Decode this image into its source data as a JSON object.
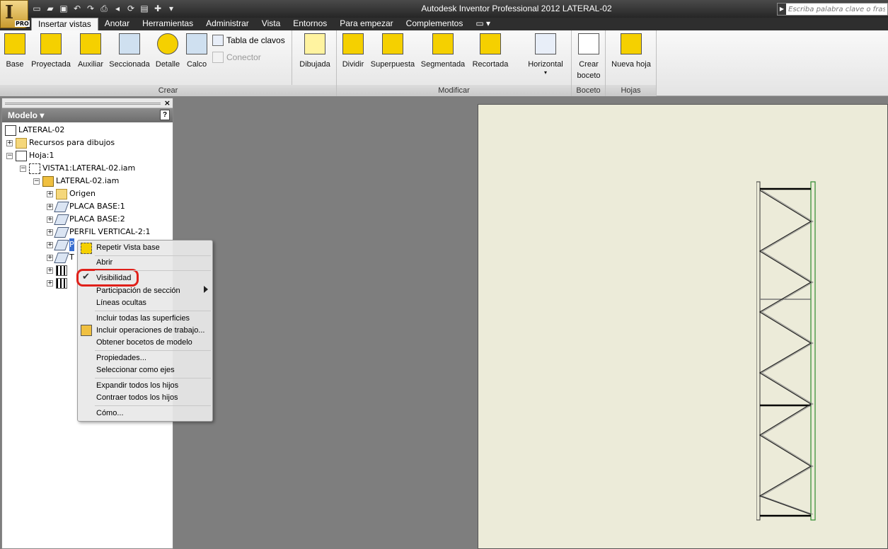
{
  "window": {
    "title": "Autodesk Inventor Professional 2012    LATERAL-02"
  },
  "app_button": {
    "badge": "PRO"
  },
  "search": {
    "placeholder": "Escriba palabra clave o frase"
  },
  "tabs": [
    "Insertar vistas",
    "Anotar",
    "Herramientas",
    "Administrar",
    "Vista",
    "Entornos",
    "Para empezar",
    "Complementos"
  ],
  "ribbon": {
    "crear": {
      "label": "Crear",
      "buttons": [
        "Base",
        "Proyectada",
        "Auxiliar",
        "Seccionada",
        "Detalle",
        "Calco"
      ],
      "small": [
        "Tabla de clavos",
        "Conector"
      ]
    },
    "dibujada": "Dibujada",
    "modificar": {
      "label": "Modificar",
      "buttons": [
        "Dividir",
        "Superpuesta",
        "Segmentada",
        "Recortada",
        "Horizontal"
      ]
    },
    "boceto": {
      "label": "Boceto",
      "button_line1": "Crear",
      "button_line2": "boceto"
    },
    "hojas": {
      "label": "Hojas",
      "button": "Nueva hoja"
    }
  },
  "browser": {
    "title": "Modelo",
    "help": "?",
    "tree": [
      {
        "label": "LATERAL-02"
      },
      {
        "label": "Recursos para dibujos"
      },
      {
        "label": "Hoja:1"
      },
      {
        "label": "VISTA1:LATERAL-02.iam"
      },
      {
        "label": "LATERAL-02.iam"
      },
      {
        "label": "Origen"
      },
      {
        "label": "PLACA BASE:1"
      },
      {
        "label": "PLACA BASE:2"
      },
      {
        "label": "PERFIL VERTICAL-2:1"
      },
      {
        "label": "P"
      },
      {
        "label": "T"
      }
    ]
  },
  "context_menu": {
    "items": [
      "Repetir Vista base",
      "Abrir",
      "Visibilidad",
      "Participación de sección",
      "Líneas ocultas",
      "Incluir todas las superficies",
      "Incluir operaciones de trabajo...",
      "Obtener bocetos de modelo",
      "Propiedades...",
      "Seleccionar como ejes",
      "Expandir todos los hijos",
      "Contraer todos los hijos",
      "Cómo..."
    ]
  },
  "colors": {
    "highlight": "#e0201a",
    "sheet": "#ecebd9",
    "canvas": "#7e7e7e"
  }
}
